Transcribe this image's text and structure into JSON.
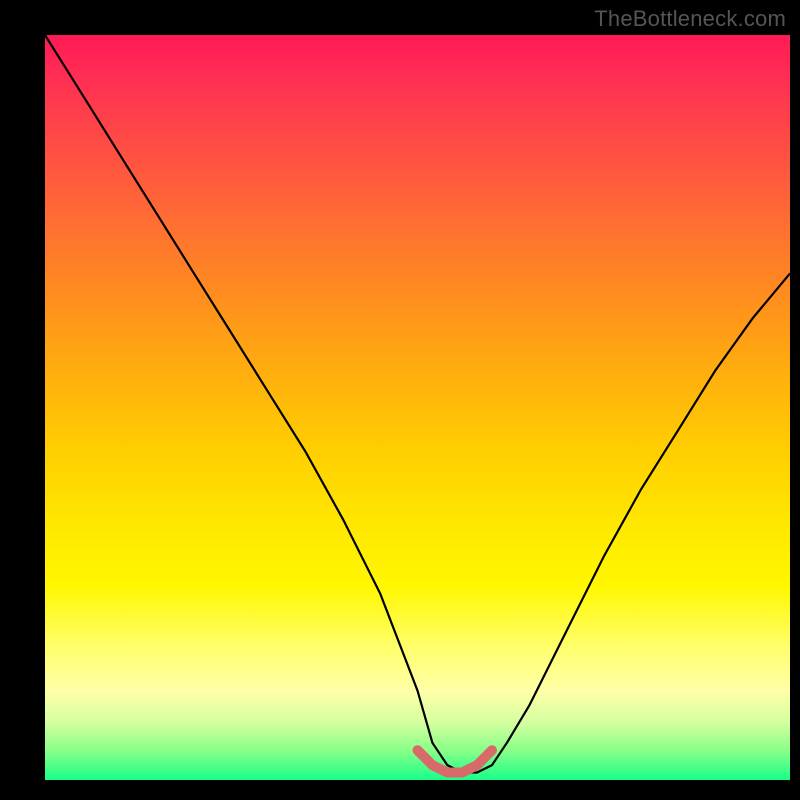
{
  "watermark": "TheBottleneck.com",
  "chart_data": {
    "type": "line",
    "title": "",
    "xlabel": "",
    "ylabel": "",
    "x_range": [
      0,
      100
    ],
    "y_range": [
      0,
      100
    ],
    "grid": false,
    "legend": false,
    "series": [
      {
        "name": "bottleneck-curve",
        "x": [
          0,
          5,
          10,
          15,
          20,
          25,
          30,
          35,
          40,
          45,
          50,
          52,
          54,
          56,
          58,
          60,
          62,
          65,
          70,
          75,
          80,
          85,
          90,
          95,
          100
        ],
        "y": [
          100,
          92,
          84,
          76,
          68,
          60,
          52,
          44,
          35,
          25,
          12,
          5,
          2,
          1,
          1,
          2,
          5,
          10,
          20,
          30,
          39,
          47,
          55,
          62,
          68
        ],
        "color": "#000000"
      }
    ],
    "highlight_segment": {
      "name": "optimal-zone",
      "x": [
        50,
        52,
        54,
        56,
        58,
        60
      ],
      "y": [
        4,
        2,
        1,
        1,
        2,
        4
      ],
      "color": "#d86a6a"
    },
    "background_gradient_stops": [
      {
        "pos": 0.0,
        "color": "#ff1a55"
      },
      {
        "pos": 0.5,
        "color": "#ffcf00"
      },
      {
        "pos": 0.88,
        "color": "#ffffa8"
      },
      {
        "pos": 1.0,
        "color": "#18ff88"
      }
    ]
  }
}
